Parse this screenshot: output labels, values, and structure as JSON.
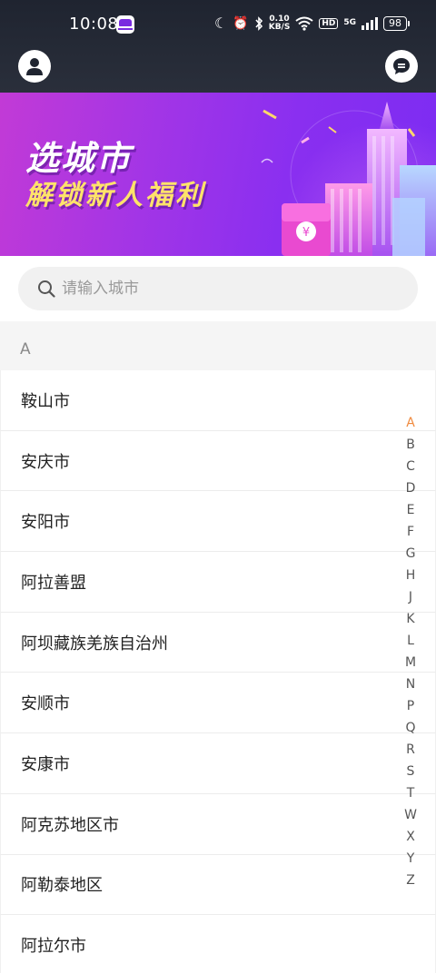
{
  "status_bar": {
    "time": "10:08",
    "speed_value": "0.10",
    "speed_unit": "KB/S",
    "hd_label": "HD",
    "network_label": "5G",
    "battery": "98"
  },
  "nav": {
    "avatar_icon": "user-icon",
    "message_icon": "chat-icon"
  },
  "banner": {
    "title_line1": "选城市",
    "title_line2": "解锁新人福利",
    "coin_symbol": "¥"
  },
  "search": {
    "placeholder": "请输入城市",
    "value": ""
  },
  "section": {
    "letter": "A"
  },
  "cities": [
    "鞍山市",
    "安庆市",
    "安阳市",
    "阿拉善盟",
    "阿坝藏族羌族自治州",
    "安顺市",
    "安康市",
    "阿克苏地区市",
    "阿勒泰地区",
    "阿拉尔市"
  ],
  "index_letters": [
    "A",
    "B",
    "C",
    "D",
    "E",
    "F",
    "G",
    "H",
    "J",
    "K",
    "L",
    "M",
    "N",
    "P",
    "Q",
    "R",
    "S",
    "T",
    "W",
    "X",
    "Y",
    "Z"
  ],
  "active_letter": "A",
  "colors": {
    "accent_active_letter": "#f08a3e",
    "banner_yellow": "#ffe36a",
    "topbar": "#1f2430"
  }
}
